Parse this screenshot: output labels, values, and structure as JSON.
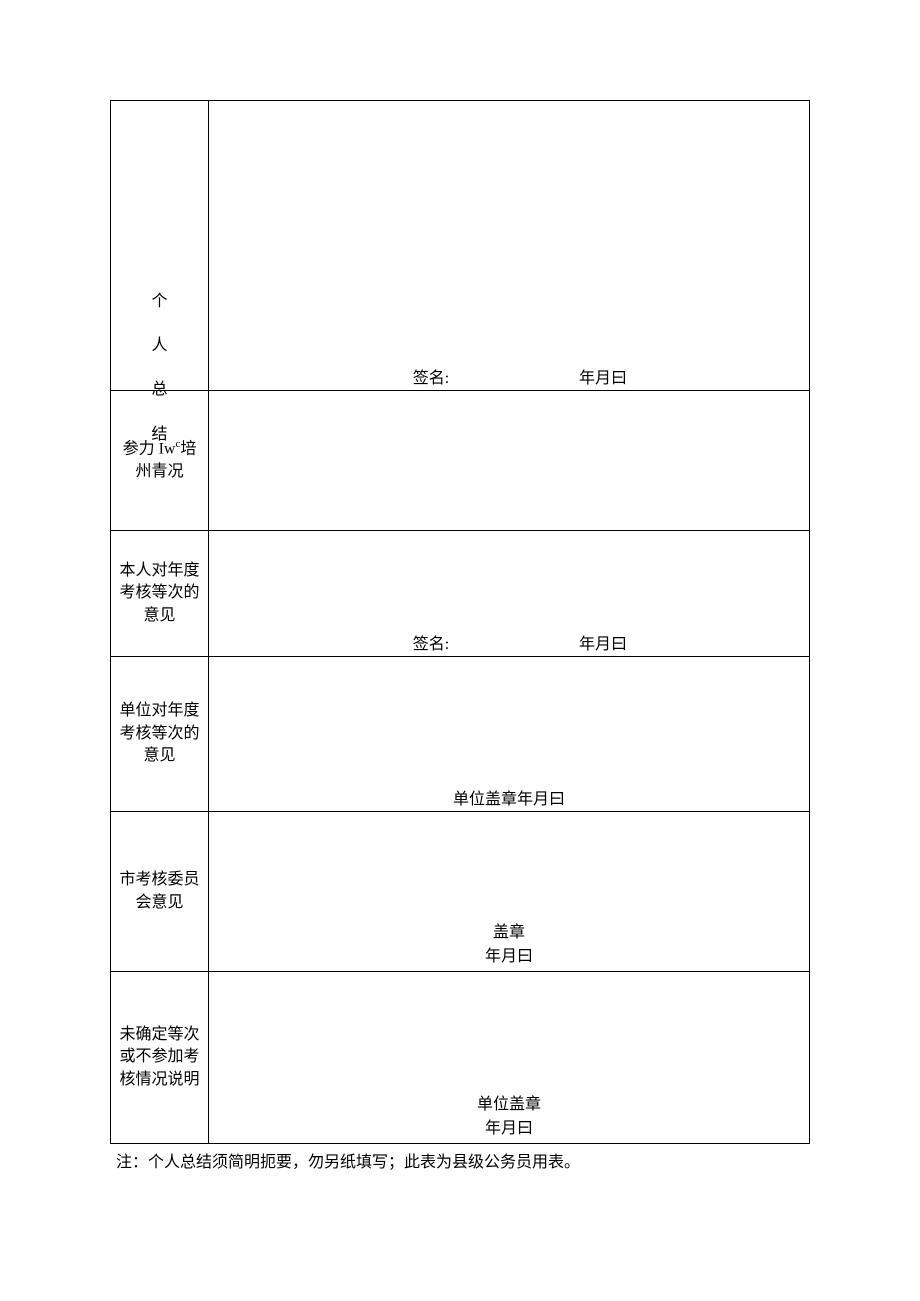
{
  "rows": {
    "r1": {
      "label_chars": [
        "个",
        "人",
        "总",
        "结"
      ],
      "sig_prefix": "签名:",
      "sig_date": "年月曰"
    },
    "r2": {
      "label_line1": "参力 Iw",
      "label_sup": "c",
      "label_line1b": "培",
      "label_line2": "州青况"
    },
    "r3": {
      "label_line1": "本人对年度",
      "label_line2": "考核等次的",
      "label_line3": "意见",
      "sig_prefix": "签名:",
      "sig_date": "年月曰"
    },
    "r4": {
      "label_line1": "单位对年度",
      "label_line2": "考核等次的",
      "label_line3": "意见",
      "stamp_line": "单位盖章年月曰"
    },
    "r5": {
      "label_line1": "市考核委员",
      "label_line2": "会意见",
      "stamp_line1": "盖章",
      "stamp_line2": "年月曰"
    },
    "r6": {
      "label_line1": "未确定等次",
      "label_line2": "或不参加考",
      "label_line3": "核情况说明",
      "stamp_line1": "单位盖章",
      "stamp_line2": "年月曰"
    }
  },
  "note": "注：个人总结须简明扼要，勿另纸填写；此表为县级公务员用表。"
}
